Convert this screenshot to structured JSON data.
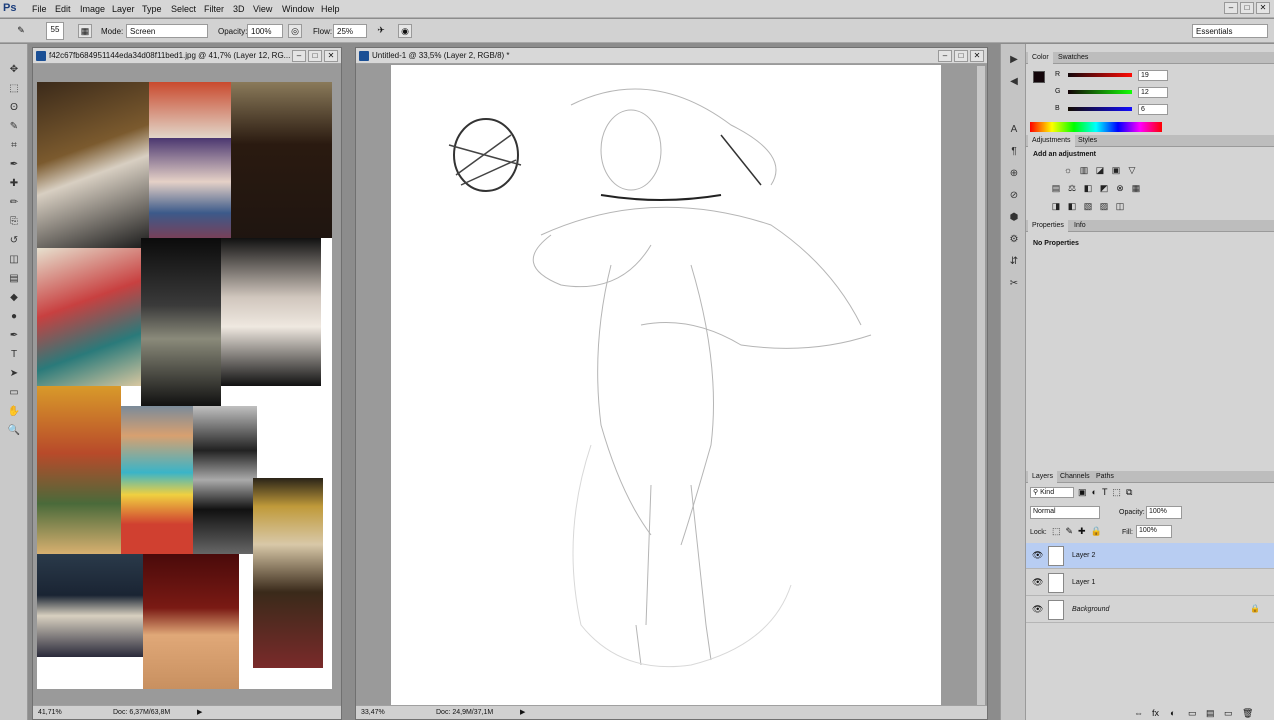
{
  "app": {
    "logo": "Ps"
  },
  "menu": [
    "File",
    "Edit",
    "Image",
    "Layer",
    "Type",
    "Select",
    "Filter",
    "3D",
    "View",
    "Window",
    "Help"
  ],
  "window_controls": [
    "–",
    "□",
    "✕"
  ],
  "options": {
    "brush_size": "55",
    "mode_label": "Mode:",
    "mode_value": "Screen",
    "opacity_label": "Opacity:",
    "opacity_value": "100%",
    "flow_label": "Flow:",
    "flow_value": "25%",
    "workspace": "Essentials"
  },
  "tools": [
    "move-tool",
    "marquee-tool",
    "lasso-tool",
    "quick-select-tool",
    "crop-tool",
    "eyedropper-tool",
    "healing-tool",
    "brush-tool",
    "stamp-tool",
    "history-brush-tool",
    "eraser-tool",
    "gradient-tool",
    "blur-tool",
    "dodge-tool",
    "pen-tool",
    "type-tool",
    "path-select-tool",
    "shape-tool",
    "hand-tool",
    "zoom-tool"
  ],
  "tool_glyphs": [
    "✥",
    "⬚",
    "ʘ",
    "✎",
    "⌗",
    "✒",
    "✚",
    "✏",
    "⎘",
    "↺",
    "◫",
    "▤",
    "◆",
    "●",
    "✒",
    "T",
    "➤",
    "▭",
    "✋",
    "🔍"
  ],
  "ref_doc": {
    "title": "f42c67fb684951144eda34d08f11bed1.jpg @ 41,7% (Layer 12, RG...",
    "zoom": "41,71%",
    "doc_size": "Doc: 6,37M/63,8M"
  },
  "canvas_doc": {
    "title": "Untitled-1 @ 33,5% (Layer 2, RGB/8) *",
    "zoom": "33,47%",
    "doc_size": "Doc: 24,9M/37,1M"
  },
  "color_panel": {
    "tabs": [
      "Color",
      "Swatches"
    ],
    "r_label": "R",
    "r_value": "19",
    "g_label": "G",
    "g_value": "12",
    "b_label": "B",
    "b_value": "6"
  },
  "adjust_panel": {
    "tabs": [
      "Adjustments",
      "Styles"
    ],
    "heading": "Add an adjustment",
    "row1": [
      "☼",
      "▥",
      "◪",
      "▣",
      "▽"
    ],
    "row2": [
      "▤",
      "⚖",
      "◧",
      "◩",
      "⊗",
      "▦"
    ],
    "row3": [
      "◨",
      "◧",
      "▧",
      "▨",
      "◫"
    ]
  },
  "props_panel": {
    "tabs": [
      "Properties",
      "Info"
    ],
    "text": "No Properties"
  },
  "layers_panel": {
    "tabs": [
      "Layers",
      "Channels",
      "Paths"
    ],
    "kind_label": "Kind",
    "blend_mode": "Normal",
    "opacity_label": "Opacity:",
    "opacity_value": "100%",
    "lock_label": "Lock:",
    "fill_label": "Fill:",
    "fill_value": "100%",
    "layers": [
      {
        "name": "Layer 2",
        "selected": true
      },
      {
        "name": "Layer 1",
        "selected": false
      },
      {
        "name": "Background",
        "selected": false,
        "locked": true
      }
    ],
    "footer_icons": [
      "⇔",
      "fx",
      "◐",
      "▭",
      "▤",
      "▭",
      "🗑"
    ]
  },
  "dock_icons": [
    "▶",
    "◀",
    "A",
    "¶",
    "⊕",
    "⊘",
    "⬢",
    "⚙",
    "⇵",
    "✂"
  ],
  "accent": "#b8cdf2"
}
